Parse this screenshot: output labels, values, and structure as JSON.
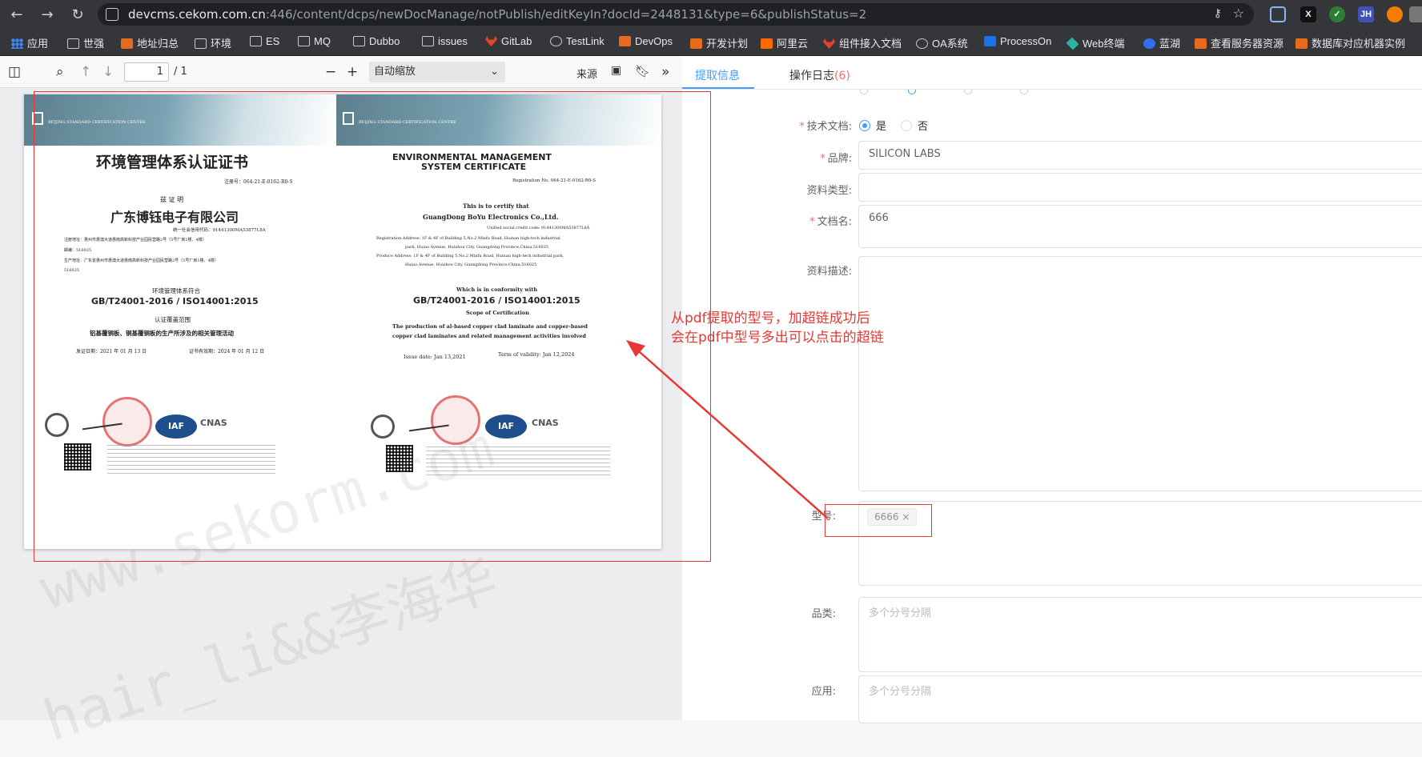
{
  "browser": {
    "url_host": "devcms.cekom.com.cn",
    "url_rest": ":446/content/dcps/newDocManage/notPublish/editKeyIn?docId=2448131&type=6&publishStatus=2"
  },
  "extensions": [
    "X",
    "JH"
  ],
  "bookmarks": [
    {
      "label": "应用",
      "icon": "apps-icon"
    },
    {
      "label": "世强",
      "icon": "folder-icon"
    },
    {
      "label": "地址归总",
      "icon": "orange-icon"
    },
    {
      "label": "环境",
      "icon": "folder-icon"
    },
    {
      "label": "ES",
      "icon": "folder-icon"
    },
    {
      "label": "MQ",
      "icon": "folder-icon"
    },
    {
      "label": "Dubbo",
      "icon": "folder-icon"
    },
    {
      "label": "issues",
      "icon": "folder-icon"
    },
    {
      "label": "GitLab",
      "icon": "gitlab-icon"
    },
    {
      "label": "TestLink",
      "icon": "globe-icon"
    },
    {
      "label": "DevOps",
      "icon": "orange-icon"
    },
    {
      "label": "开发计划",
      "icon": "orange-icon"
    },
    {
      "label": "阿里云",
      "icon": "aliyun-icon"
    },
    {
      "label": "组件接入文档",
      "icon": "gitlab-icon"
    },
    {
      "label": "OA系统",
      "icon": "e-icon"
    },
    {
      "label": "ProcessOn",
      "icon": "on-icon"
    },
    {
      "label": "Web终端",
      "icon": "layers-icon"
    },
    {
      "label": "蓝湖",
      "icon": "lanhu-icon"
    },
    {
      "label": "查看服务器资源",
      "icon": "orange-icon"
    },
    {
      "label": "数据库对应机器实例",
      "icon": "orange-icon"
    }
  ],
  "pdf_toolbar": {
    "page_current": "1",
    "page_total": "/ 1",
    "zoom": "自动缩放",
    "source_label": "来源"
  },
  "certificate": {
    "cn_title": "环境管理体系认证证书",
    "cn_reg": "注册号：064-21-E-0162-R0-S",
    "cn_certify": "兹 证 明",
    "cn_company": "广东博钰电子有限公司",
    "cn_credit": "统一社会信用代码：91441300MA53877L8A",
    "cn_addr1": "注册地址：惠州市惠澳大道惠南高新科技产业园民营路2号（5号厂房1楼、4楼）",
    "cn_zip": "邮编：516025",
    "cn_addr2": "生产地址：广东省惠州市惠澳大道惠南高新科技产业园民营路2号（5号厂房1楼、4楼）",
    "cn_zip2": "516025",
    "cn_conform": "环境管理体系符合",
    "cn_std": "GB/T24001-2016 / ISO14001:2015",
    "cn_scope_title": "认证覆盖范围",
    "cn_scope": "铝基覆铜板、铜基覆铜板的生产所涉及的相关管理活动",
    "cn_issue": "发证日期：2021 年 01 月 13 日",
    "cn_valid": "证书有效期：2024 年 01 月 12 日",
    "en_title1": "ENVIRONMENTAL MANAGEMENT",
    "en_title2": "SYSTEM CERTIFICATE",
    "en_reg": "Registration No. 064-21-E-0162-R0-S",
    "en_certify": "This is to certify that",
    "en_company": "GuangDong BoYu Electronics Co.,Ltd.",
    "en_credit": "Unified social credit code: 91441300MA53877L8A",
    "en_addr1": "Registration Address: 1F & 4F of Building 5,No.2 Minfu Road, Huinan high-tech industrial",
    "en_addr1b": "park, Huiao Avenue, Huizhou City, Guangdong Province,China,516025",
    "en_addr2": "Produce Address: 1F & 4F of Building 5,No.2 Minfu Road, Huinan high-tech industrial park,",
    "en_addr2b": "Huiao Avenue, Huizhou City, Guangdong Province,China,516025",
    "en_conform": "Which is in conformity with",
    "en_std": "GB/T24001-2016 / ISO14001:2015",
    "en_scope_title": "Scope of Certification",
    "en_scope1": "The production of al-based copper clad laminate and copper-based",
    "en_scope2": "copper clad laminates and related management activities involved",
    "en_issue": "Issue date: Jan 13,2021",
    "en_valid": "Term of validity: Jan 12,2024",
    "logo_iaf": "IAF",
    "logo_cnas": "CNAS",
    "centre": "BEIJING STANDARD CERTIFICATION CENTRE"
  },
  "tabs": {
    "extract": "提取信息",
    "log": "操作日志",
    "log_count": "(6)"
  },
  "form": {
    "tech_doc_label": "技术文档:",
    "yes": "是",
    "no": "否",
    "brand_label": "品牌:",
    "brand_value": "SILICON LABS",
    "type_label": "资料类型:",
    "docname_label": "文档名:",
    "docname_value": "666",
    "desc_label": "资料描述:",
    "model_label": "型号:",
    "model_tag": "6666",
    "category_label": "品类:",
    "category_placeholder": "多个分号分隔",
    "app_label": "应用:",
    "app_placeholder": "多个分号分隔"
  },
  "annotation": {
    "line1": "从pdf提取的型号，加超链成功后",
    "line2": "会在pdf中型号多出可以点击的超链"
  },
  "watermark": {
    "line1": "www.sekorm.com",
    "line2": "hair_li&&李海华"
  },
  "colors": {
    "accent": "#409eff",
    "required": "#f56c6c",
    "annotation": "#e53935"
  }
}
